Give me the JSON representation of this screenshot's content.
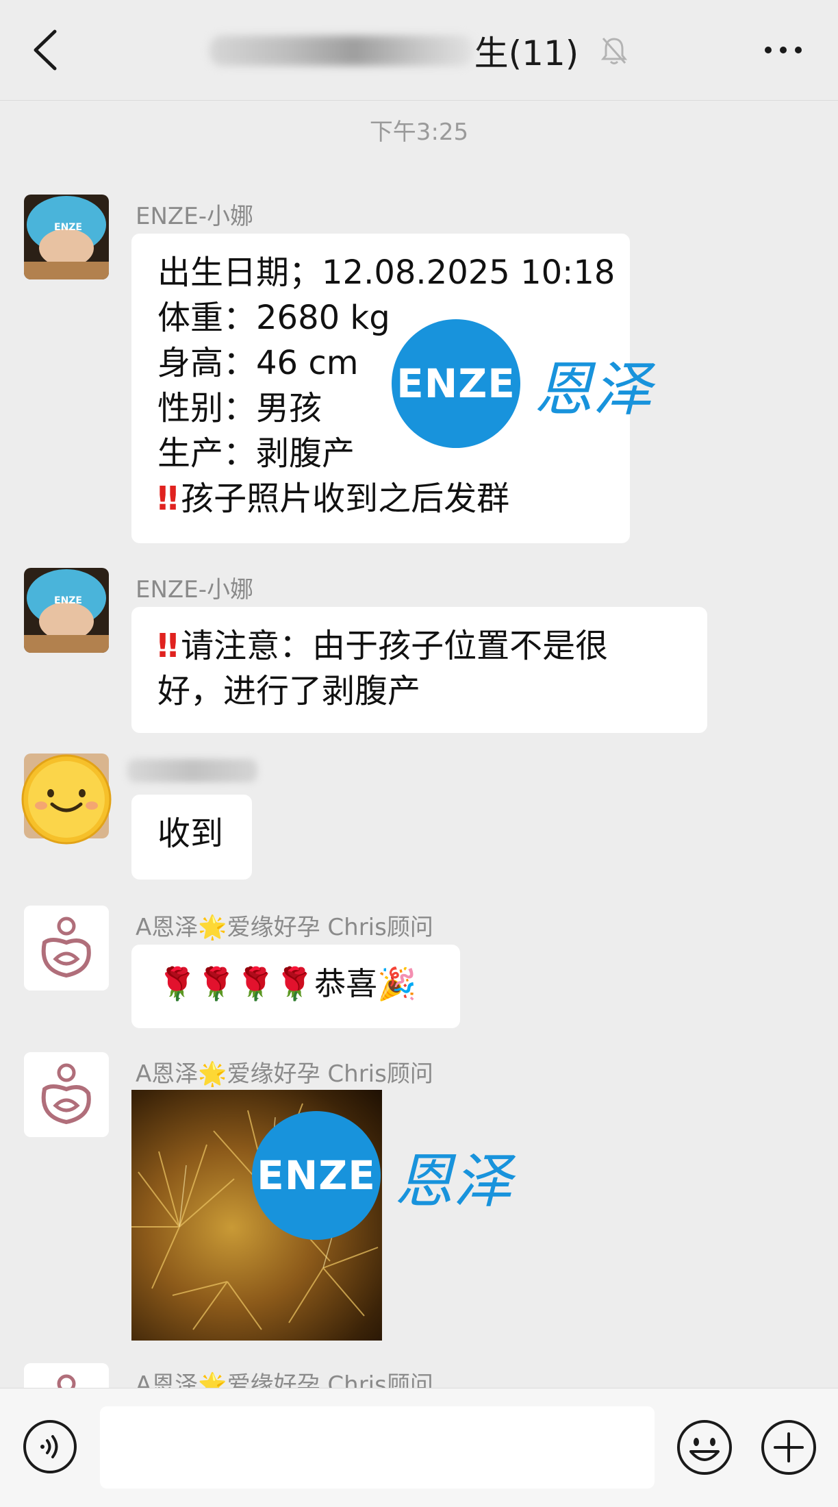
{
  "header": {
    "title_visible": "生(11)",
    "back_icon": "chevron-left-icon",
    "mute_icon": "bell-off-icon",
    "more_icon": "more-horizontal-icon"
  },
  "timestamp": "下午3:25",
  "messages": [
    {
      "sender": "ENZE-小娜",
      "lines": [
        "出生日期；12.08.2025 10:18",
        "体重：2680 kg",
        "身高：46 cm",
        "性别：男孩",
        "生产：剥腹产",
        "孩子照片收到之后发群"
      ],
      "alert_mark": "‼"
    },
    {
      "sender": "ENZE-小娜",
      "lines": [
        "请注意：由于孩子位置不是很",
        "好，进行了剥腹产"
      ],
      "alert_mark": "‼"
    },
    {
      "sender": "",
      "lines": [
        "收到"
      ]
    },
    {
      "sender": "A恩泽🌟爱缘好孕 Chris顾问",
      "lines": [
        "🌹🌹🌹🌹恭喜🎉"
      ]
    },
    {
      "sender": "A恩泽🌟爱缘好孕 Chris顾问",
      "image": "fireworks-photo"
    },
    {
      "sender": "A恩泽🌟爱缘好孕 Chris顾问"
    }
  ],
  "watermarks": [
    {
      "logo_text": "ENZE",
      "brand_text": "恩泽"
    },
    {
      "logo_text": "ENZE",
      "brand_text": "恩泽"
    }
  ],
  "input": {
    "voice_icon": "voice-icon",
    "emoji_icon": "emoji-icon",
    "plus_icon": "plus-circle-icon"
  },
  "colors": {
    "background": "#ededed",
    "bubble": "#ffffff",
    "alert_red": "#e0221f",
    "watermark_blue": "#1893dc"
  }
}
